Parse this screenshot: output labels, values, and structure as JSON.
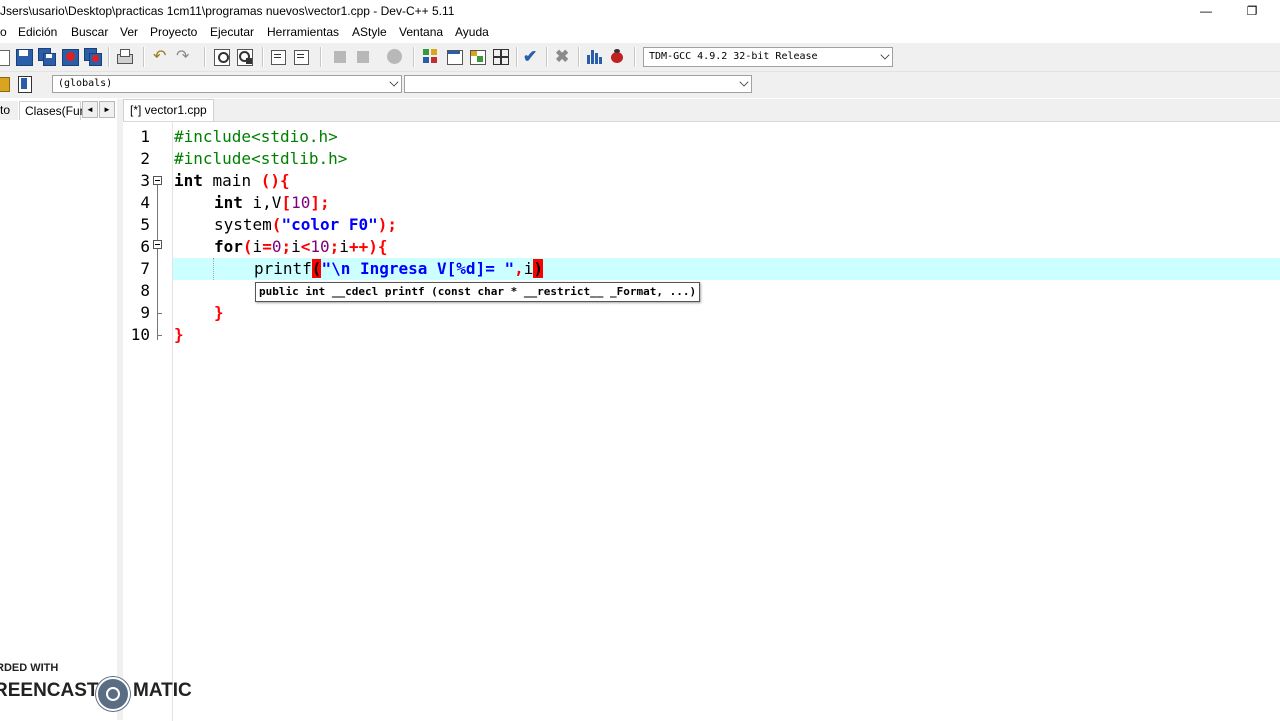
{
  "window": {
    "title": "Jsers\\usario\\Desktop\\practicas 1cm11\\programas nuevos\\vector1.cpp - Dev-C++ 5.11",
    "minimize_glyph": "—",
    "maximize_glyph": "❐"
  },
  "menu": {
    "items": [
      "o",
      "Edición",
      "Buscar",
      "Ver",
      "Proyecto",
      "Ejecutar",
      "Herramientas",
      "AStyle",
      "Ventana",
      "Ayuda"
    ]
  },
  "toolbar": {
    "compiler": "TDM-GCC 4.9.2 32-bit Release",
    "icons": [
      "new-file-icon",
      "save-icon",
      "save-all-icon",
      "close-file-icon",
      "close-all-icon",
      "print-icon",
      "undo-icon",
      "redo-icon",
      "find-icon",
      "replace-icon",
      "indent-icon",
      "unindent-icon",
      "bookmark-prev-icon",
      "bookmark-next-icon",
      "goto-icon",
      "new-class-icon",
      "new-project-icon",
      "open-project-icon",
      "project-options-icon",
      "check-icon",
      "stop-icon",
      "chart-icon",
      "debug-icon"
    ]
  },
  "toolbar2": {
    "scope": "(globals)",
    "symbol": ""
  },
  "leftpanel": {
    "tab_project": "to",
    "tab_classes": "Clases(Fun",
    "prev": "◄",
    "next": "►"
  },
  "editor": {
    "tab_label": "[*] vector1.cpp",
    "line_numbers": [
      "1",
      "2",
      "3",
      "4",
      "5",
      "6",
      "7",
      "8",
      "9",
      "10"
    ],
    "lines": {
      "l1": "#include<stdio.h>",
      "l2": "#include<stdlib.h>",
      "l3_kw": "int",
      "l3_id": " main ",
      "l3_sym": "(){",
      "l4_kw": "int",
      "l4_id": " i,V",
      "l4_s1": "[",
      "l4_num": "10",
      "l4_s2": "];",
      "l5_id": "system",
      "l5_s1": "(",
      "l5_str": "\"color F0\"",
      "l5_s2": ");",
      "l6_kw": "for",
      "l6_s1": "(",
      "l6_a": "i",
      "l6_s2": "=",
      "l6_n1": "0",
      "l6_s3": ";",
      "l6_b": "i",
      "l6_s4": "<",
      "l6_n2": "10",
      "l6_s5": ";",
      "l6_c": "i",
      "l6_s6": "++){",
      "l7_id": "printf",
      "l7_b1": "(",
      "l7_str": "\"\\n Ingresa V[%d]= \"",
      "l7_s1": ",",
      "l7_id2": "i",
      "l7_b2": ")",
      "l9": "}",
      "l10": "}"
    },
    "tooltip": "public int __cdecl printf (const char * __restrict__ _Format, ...)"
  },
  "watermark": {
    "line1": "RDED WITH",
    "line2": "REENCAST",
    "line3": "MATIC"
  }
}
